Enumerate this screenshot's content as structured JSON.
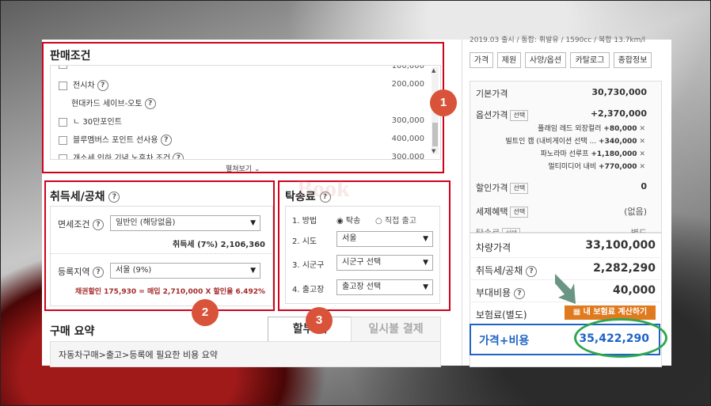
{
  "top_note": "2019.03 출시 / 통합: 휘발유 / 1590cc / 복합 13.7km/l",
  "sale": {
    "title": "판매조건",
    "items": [
      {
        "label": "· ",
        "value": "100,000",
        "checkbox": true,
        "help": false
      },
      {
        "label": "전시차",
        "value": "200,000",
        "checkbox": true,
        "help": true
      },
      {
        "label": "현대카드 세이브-오토",
        "value": "",
        "checkbox": false,
        "help": true
      },
      {
        "label": "ㄴ 30만포인트",
        "value": "300,000",
        "checkbox": true,
        "help": false
      },
      {
        "label": "블루멤버스 포인트 선사용",
        "value": "400,000",
        "checkbox": true,
        "help": true
      },
      {
        "label": "개소세 인하 기념 노후차 조건",
        "value": "300,000",
        "checkbox": true,
        "help": true
      }
    ],
    "expand": "펼쳐보기"
  },
  "tax": {
    "title": "취득세/공채",
    "exempt_label": "면세조건",
    "exempt_value": "일반인 (해당없음)",
    "tax_line": "취득세 (7%) 2,106,360",
    "region_label": "등록지역",
    "region_value": "서울 (9%)",
    "bond_line": "채권할인 175,930 = 매입 2,710,000 X 할인율 6.492%"
  },
  "delivery": {
    "title": "탁송료",
    "method_label": "1. 방법",
    "method_opt1": "탁송",
    "method_opt2": "직접 출고",
    "city_label": "2. 시도",
    "city_value": "서울",
    "district_label": "3. 시군구",
    "district_value": "시군구 선택",
    "depot_label": "4. 출고장",
    "depot_value": "출고장 선택"
  },
  "summary": {
    "title": "구매 요약",
    "tab_installment": "할부",
    "tab_installment_suffix": "제",
    "tab_lump": "일시불 결제",
    "desc": "자동차구매>출고>등록에 필요한 비용 요약"
  },
  "right": {
    "tabs": [
      "가격",
      "제원",
      "사양/옵션",
      "카탈로그",
      "종합정보"
    ],
    "base_label": "기본가격",
    "base_value": "30,730,000",
    "option_label": "옵션가격",
    "select_tag": "선택",
    "option_value": "+2,370,000",
    "options": [
      {
        "name": "플래임 레드 외장컬러",
        "price": "+80,000"
      },
      {
        "name": "빌트인 캠 (내비게이션 선택 ...",
        "price": "+340,000"
      },
      {
        "name": "파노라마 선루프",
        "price": "+1,180,000"
      },
      {
        "name": "멀티미디어 내비",
        "price": "+770,000"
      }
    ],
    "discount_label": "할인가격",
    "discount_value": "0",
    "tax_benefit_label": "세제혜택",
    "tax_benefit_value": "(없음)",
    "delivery_label": "탁송료",
    "delivery_value": "별도",
    "car_price_label": "차량가격",
    "car_price_value": "33,100,000",
    "tax_label": "취득세/공채",
    "tax_value": "2,282,290",
    "extra_label": "부대비용",
    "extra_value": "40,000",
    "insurance_label": "보험료(별도)",
    "insurance_btn": "내 보험료 계산하기",
    "total_label": "가격+비용",
    "total_value": "35,422,290"
  },
  "badges": [
    "1",
    "2",
    "3"
  ],
  "watermark": "Book",
  "colors": {
    "accent_blue": "#1f63c6",
    "highlight_red": "#d0021b",
    "badge": "#d9533a",
    "circle_green": "#2fa84f",
    "arrow": "#5a8a75",
    "insurance_btn": "#e07a1e"
  }
}
